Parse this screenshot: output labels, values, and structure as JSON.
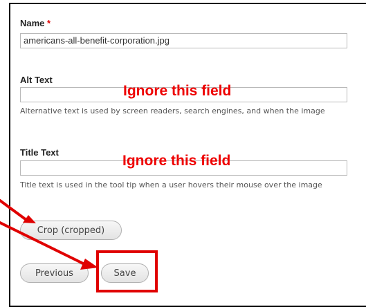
{
  "fields": {
    "name": {
      "label": "Name",
      "required_marker": "*",
      "value": "americans-all-benefit-corporation.jpg"
    },
    "alt_text": {
      "label": "Alt Text",
      "value": "",
      "annotation": "Ignore this field",
      "description": "Alternative text is used by screen readers, search engines, and when the image"
    },
    "title_text": {
      "label": "Title Text",
      "value": "",
      "annotation": "Ignore this field",
      "description": "Title text is used in the tool tip when a user hovers their mouse over the image"
    }
  },
  "buttons": {
    "crop": "Crop (cropped)",
    "previous": "Previous",
    "save": "Save"
  },
  "colors": {
    "annotation": "#ee0000",
    "required": "#e00000",
    "frame_border": "#000000"
  }
}
